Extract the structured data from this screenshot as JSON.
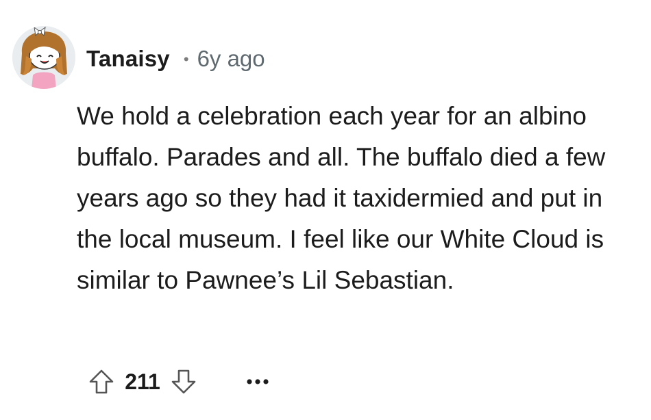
{
  "comment": {
    "author": "Tanaisy",
    "separator": "•",
    "age": "6y ago",
    "body": "We hold a celebration each year for an albino buffalo. Parades and all. The buffalo died a few years ago so they had it taxidermied and put in the local museum. I feel like our White Cloud is similar to Pawnee’s Lil Sebastian.",
    "score": "211"
  },
  "icons": {
    "upvote": "arrow-up-outline",
    "downvote": "arrow-down-outline",
    "more": "horizontal-ellipsis"
  },
  "colors": {
    "text": "#1c1c1c",
    "meta": "#5f6a70",
    "icon": "#555555",
    "background": "#ffffff"
  }
}
